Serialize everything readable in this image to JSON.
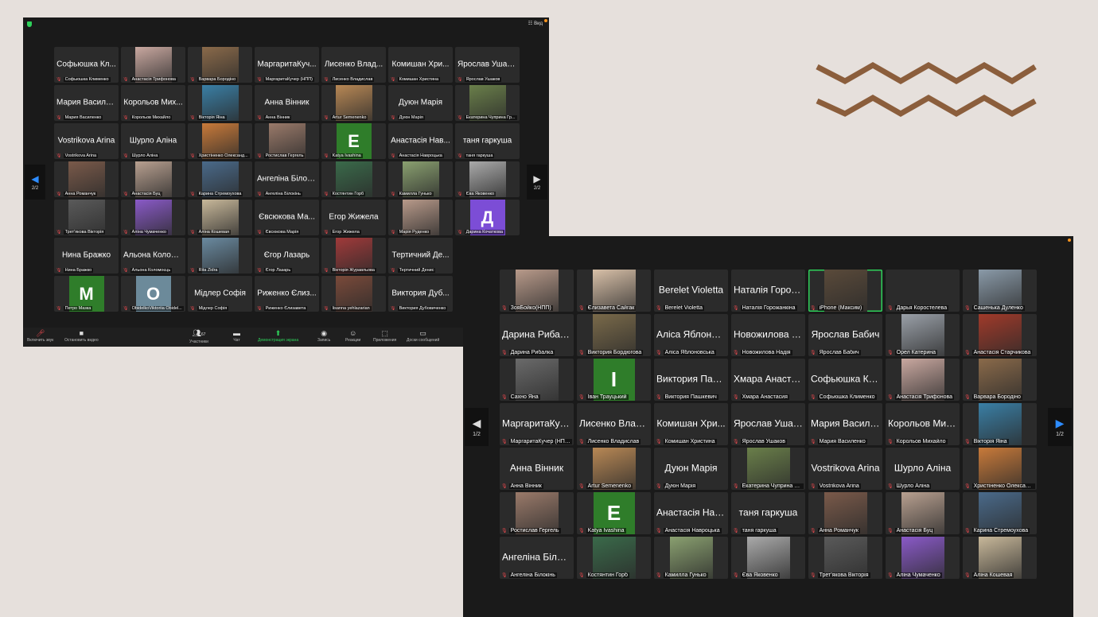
{
  "colors": {
    "accent_blue": "#2d8cff",
    "share_green": "#2ed15a",
    "muted_red": "#e5484d",
    "decor_brown": "#8b5e3c"
  },
  "window1": {
    "view_label": "Вид",
    "page_left": "2/2",
    "page_right": "2/2",
    "tiles": [
      {
        "name": "Софьюшка Кл...",
        "label": "Софьюшка Клименко"
      },
      {
        "photo": "#c9a8a0",
        "label": "Анастасія Трифонова"
      },
      {
        "photo": "#8a6a4a",
        "label": "Варвара Бородіно"
      },
      {
        "name": "МаргаритаКуч...",
        "label": "МаргаритаКучер (НПП)"
      },
      {
        "name": "Лисенко Влад...",
        "label": "Лисенко Владислав"
      },
      {
        "name": "Комишан Хри...",
        "label": "Комишан Христина"
      },
      {
        "name": "Ярослав Ушак...",
        "label": "Ярослав Ушаков"
      },
      {
        "name": "Мария Василе...",
        "label": "Мария Василенко"
      },
      {
        "name": "Корольов Мих...",
        "label": "Корольов Михайло"
      },
      {
        "photo": "#3a7fa5",
        "label": "Вікторія Яіна"
      },
      {
        "name": "Анна Вінник",
        "label": "Анна Вінник"
      },
      {
        "photo": "#b88855",
        "label": "Artur Semenenko"
      },
      {
        "name": "Дуюн Марія",
        "label": "Дуюн Марія"
      },
      {
        "photo": "#6a7f4a",
        "label": "Екатерина Чуприна Гр..."
      },
      {
        "name": "Vostrikova Arina",
        "label": "Vostrikova Arina"
      },
      {
        "name": "Шурло Аліна",
        "label": "Шурло Аліна"
      },
      {
        "photo": "#c87a3a",
        "label": "Христіненко Олександ..."
      },
      {
        "photo": "#9a7a6a",
        "label": "Ростислав Гергель"
      },
      {
        "avatar": "E",
        "avatar_color": "#2f7d2a",
        "label": "Katya Ivashina"
      },
      {
        "name": "Анастасія Нав...",
        "label": "Анастасія Навроцька"
      },
      {
        "name": "таня гаркуша",
        "label": "таня гаркуша"
      },
      {
        "photo": "#7a5a4a",
        "label": "Анна Романчук"
      },
      {
        "photo": "#b8a090",
        "label": "Анастасія Буц"
      },
      {
        "photo": "#4a6a8a",
        "label": "Карина Стремоухова"
      },
      {
        "name": "Ангеліна Білок...",
        "label": "Ангеліна Білокінь"
      },
      {
        "photo": "#3a6a4a",
        "label": "Костянтин Горб"
      },
      {
        "photo": "#8aa070",
        "label": "Камилла Гунько"
      },
      {
        "photo": "#aaaaaa",
        "label": "Єва Яковенко"
      },
      {
        "photo": "#5a5a5a",
        "label": "Трет'якова Вікторія"
      },
      {
        "photo": "#8a5ac8",
        "label": "Аліна Чумаченко"
      },
      {
        "photo": "#c8b89a",
        "label": "Аліна Кошевая"
      },
      {
        "name": "Євсюкова Ма...",
        "label": "Євсюкова Марія"
      },
      {
        "name": "Егор Жижела",
        "label": "Егор Жижела"
      },
      {
        "photo": "#b89a8a",
        "label": "Марія Руденко"
      },
      {
        "avatar": "Д",
        "avatar_color": "#7c4dd6",
        "label": "Дарина Кочаткова"
      },
      {
        "name": "Нина Бражко",
        "label": "Нина Бражко"
      },
      {
        "name": "Альона Колом...",
        "label": "Альона Коломоєць"
      },
      {
        "photo": "#6a8aa0",
        "label": "Rita Zidra"
      },
      {
        "name": "Єгор Лазарь",
        "label": "Єгор Лазарь"
      },
      {
        "photo": "#a03a3a",
        "label": "Вікторія Журавльова"
      },
      {
        "name": "Тертичний Де...",
        "label": "Тертичний Денис"
      },
      {
        "blank": true,
        "label": ""
      },
      {
        "avatar": "M",
        "avatar_color": "#2f7d2a",
        "label": "Петро Мазка"
      },
      {
        "avatar": "O",
        "avatar_color": "#6c8a9a",
        "label": "ObidelkoViktoriia Obidel..."
      },
      {
        "name": "Мідлер Софія",
        "label": "Мідлер Софія"
      },
      {
        "name": "Риженко Єлиз...",
        "label": "Риженко Єлизавета"
      },
      {
        "photo": "#7a4a3a",
        "label": "lisanna yehlazarian"
      },
      {
        "name": "Виктория Дуб...",
        "label": "Виктория Дубовиченко"
      }
    ],
    "toolbar": {
      "unmute": "Включить звук",
      "stop_video": "Остановить видео",
      "participants": "Участники",
      "participants_count": "67",
      "chat": "Чат",
      "share": "Демонстрация экрана",
      "record": "Запись",
      "reactions": "Реакции",
      "apps": "Приложения",
      "whiteboards": "Доски сообщений"
    }
  },
  "window2": {
    "page_left": "1/2",
    "page_right": "1/2",
    "tiles": [
      {
        "photo": "#b89a8a",
        "label": "ЗояБойко(НПП)"
      },
      {
        "photo": "#d8c0a8",
        "label": "Єлизавета Сайгак"
      },
      {
        "name": "Berelet Violetta",
        "label": "Berelet Violetta"
      },
      {
        "name": "Наталія Горож...",
        "label": "Наталія Горожанкіна"
      },
      {
        "photo": "#5a4a3a",
        "label": "iPhone (Максим)",
        "active": true
      },
      {
        "blank": true,
        "label": "Дарья Коростелева"
      },
      {
        "photo": "#8a9aa8",
        "label": "Сашенька Дуленко"
      },
      {
        "name": "Дарина Рибал...",
        "label": "Дарина Рибалка"
      },
      {
        "photo": "#7a6a4a",
        "label": "Виктория Бордюгова"
      },
      {
        "name": "Аліса Яблонов...",
        "label": "Аліса Яблоновська"
      },
      {
        "name": "Новожилова Н...",
        "label": "Новожилова Надія"
      },
      {
        "name": "Ярослав Бабич",
        "label": "Ярослав Бабич"
      },
      {
        "photo": "#9aa0a8",
        "label": "Орел Катерина"
      },
      {
        "photo": "#a03a2a",
        "label": "Анастасія Старчикова"
      },
      {
        "photo": "#6a6a6a",
        "label": "Сахно Яна"
      },
      {
        "avatar": "I",
        "avatar_color": "#2f7d2a",
        "label": "Іван Трауцький"
      },
      {
        "name": "Виктория Паш...",
        "label": "Виктория Пашкевич"
      },
      {
        "name": "Хмара Анаста...",
        "label": "Хмара Анастасия"
      },
      {
        "name": "Софьюшка Кл...",
        "label": "Софьюшка Клименко"
      },
      {
        "photo": "#c9a8a0",
        "label": "Анастасія Трифонова"
      },
      {
        "photo": "#8a6a4a",
        "label": "Варвара Бородіно"
      },
      {
        "name": "МаргаритаКуч...",
        "label": "МаргаритаКучер (НПП)"
      },
      {
        "name": "Лисенко Влад...",
        "label": "Лисенко Владислав"
      },
      {
        "name": "Комишан Хри...",
        "label": "Комишан Христина"
      },
      {
        "name": "Ярослав Ушак...",
        "label": "Ярослав Ушаков"
      },
      {
        "name": "Мария Василе...",
        "label": "Мария Василенко"
      },
      {
        "name": "Корольов Мих...",
        "label": "Корольов Михайло"
      },
      {
        "photo": "#3a7fa5",
        "label": "Вікторія Яіна"
      },
      {
        "name": "Анна Вінник",
        "label": "Анна Вінник"
      },
      {
        "photo": "#b88855",
        "label": "Artur Semenenko"
      },
      {
        "name": "Дуюн Марія",
        "label": "Дуюн Марія"
      },
      {
        "photo": "#6a7f4a",
        "label": "Екатерина Чуприна Гр..."
      },
      {
        "name": "Vostrikova Arina",
        "label": "Vostrikova Arina"
      },
      {
        "name": "Шурло Аліна",
        "label": "Шурло Аліна"
      },
      {
        "photo": "#c87a3a",
        "label": "Христіненко Олександ..."
      },
      {
        "photo": "#9a7a6a",
        "label": "Ростислав Гергель"
      },
      {
        "avatar": "E",
        "avatar_color": "#2f7d2a",
        "label": "Katya Ivashina"
      },
      {
        "name": "Анастасія Нав...",
        "label": "Анастасія Навроцька"
      },
      {
        "name": "таня гаркуша",
        "label": "таня гаркуша"
      },
      {
        "photo": "#7a5a4a",
        "label": "Анна Романчук"
      },
      {
        "photo": "#b8a090",
        "label": "Анастасія Буц"
      },
      {
        "photo": "#4a6a8a",
        "label": "Карина Стремоухова"
      },
      {
        "name": "Ангеліна Білок...",
        "label": "Ангеліна Білокінь"
      },
      {
        "photo": "#3a6a4a",
        "label": "Костянтин Горб"
      },
      {
        "photo": "#8aa070",
        "label": "Камилла Гунько"
      },
      {
        "photo": "#aaaaaa",
        "label": "Єва Яковенко"
      },
      {
        "photo": "#5a5a5a",
        "label": "Трет'якова Вікторія"
      },
      {
        "photo": "#8a5ac8",
        "label": "Аліна Чумаченко"
      },
      {
        "photo": "#c8b89a",
        "label": "Аліна Кошевая"
      }
    ]
  }
}
